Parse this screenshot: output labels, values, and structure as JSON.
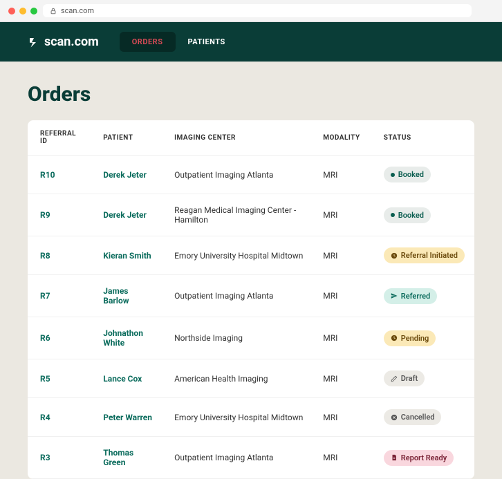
{
  "browser": {
    "url": "scan.com"
  },
  "brand": {
    "name": "scan.com"
  },
  "nav": {
    "tabs": [
      {
        "label": "ORDERS",
        "active": true
      },
      {
        "label": "PATIENTS",
        "active": false
      }
    ]
  },
  "page": {
    "title": "Orders"
  },
  "table": {
    "columns": {
      "referral_id": "REFERRAL ID",
      "patient": "PATIENT",
      "imaging_center": "IMAGING CENTER",
      "modality": "MODALITY",
      "status": "STATUS"
    },
    "rows": [
      {
        "referral_id": "R10",
        "patient": "Derek Jeter",
        "center": "Outpatient Imaging Atlanta",
        "modality": "MRI",
        "status": {
          "label": "Booked",
          "kind": "booked"
        }
      },
      {
        "referral_id": "R9",
        "patient": "Derek Jeter",
        "center": "Reagan Medical Imaging Center - Hamilton",
        "modality": "MRI",
        "status": {
          "label": "Booked",
          "kind": "booked"
        }
      },
      {
        "referral_id": "R8",
        "patient": "Kieran Smith",
        "center": "Emory University Hospital Midtown",
        "modality": "MRI",
        "status": {
          "label": "Referral Initiated",
          "kind": "referral-initiated"
        }
      },
      {
        "referral_id": "R7",
        "patient": "James Barlow",
        "center": "Outpatient Imaging Atlanta",
        "modality": "MRI",
        "status": {
          "label": "Referred",
          "kind": "referred"
        }
      },
      {
        "referral_id": "R6",
        "patient": "Johnathon White",
        "center": "Northside Imaging",
        "modality": "MRI",
        "status": {
          "label": "Pending",
          "kind": "pending"
        }
      },
      {
        "referral_id": "R5",
        "patient": "Lance Cox",
        "center": "American Health Imaging",
        "modality": "MRI",
        "status": {
          "label": "Draft",
          "kind": "draft"
        }
      },
      {
        "referral_id": "R4",
        "patient": "Peter Warren",
        "center": "Emory University Hospital Midtown",
        "modality": "MRI",
        "status": {
          "label": "Cancelled",
          "kind": "cancelled"
        }
      },
      {
        "referral_id": "R3",
        "patient": "Thomas Green",
        "center": "Outpatient Imaging Atlanta",
        "modality": "MRI",
        "status": {
          "label": "Report Ready",
          "kind": "report-ready"
        }
      }
    ]
  },
  "status_styles": {
    "booked": {
      "bg": "#e8ecea",
      "fg": "#0a5d4f",
      "icon": "dot"
    },
    "referral-initiated": {
      "bg": "#fbe9b7",
      "fg": "#6b4a0c",
      "icon": "clock"
    },
    "referred": {
      "bg": "#d4efe8",
      "fg": "#0a6b5c",
      "icon": "send"
    },
    "pending": {
      "bg": "#fbe9b7",
      "fg": "#6b4a0c",
      "icon": "clock"
    },
    "draft": {
      "bg": "#eceae5",
      "fg": "#555",
      "icon": "edit"
    },
    "cancelled": {
      "bg": "#eceae5",
      "fg": "#555",
      "icon": "x"
    },
    "report-ready": {
      "bg": "#f9d7de",
      "fg": "#7a2336",
      "icon": "doc"
    }
  }
}
